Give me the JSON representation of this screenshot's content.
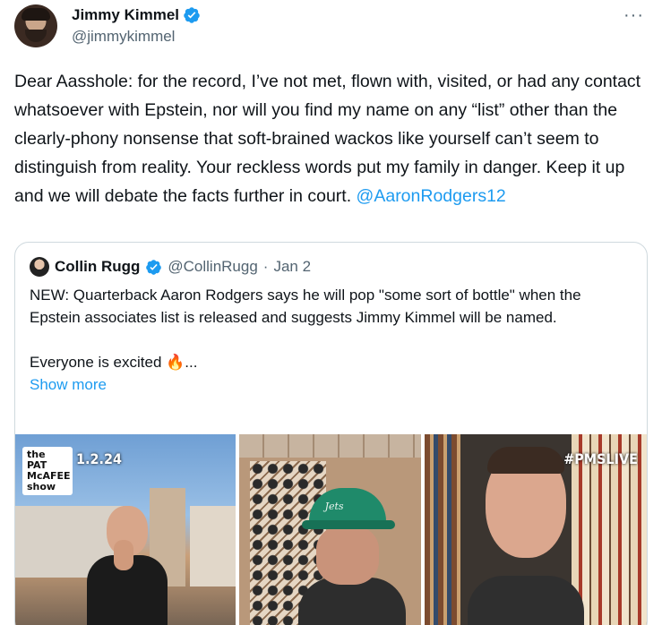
{
  "tweet": {
    "author_name": "Jimmy Kimmel",
    "author_handle": "@jimmykimmel",
    "more_label": "···",
    "text_main": "Dear Aasshole: for the record, I’ve not met, flown with, visited, or had any contact whatsoever with Epstein, nor will you find my name on any “list” other than the clearly-phony nonsense that soft-brained wackos like yourself can’t seem to distinguish from reality. Your reckless words put my family in danger. Keep it up and we will debate the facts further in court.",
    "mention": "@AaronRodgers12"
  },
  "quote": {
    "author_name": "Collin Rugg",
    "author_handle": "@CollinRugg",
    "separator": "·",
    "date": "Jan 2",
    "text_p1": "NEW: Quarterback Aaron Rodgers says he will pop \"some sort of bottle\" when the Epstein associates list is released and suggests Jimmy Kimmel will be named.",
    "text_p2": "Everyone is excited 🔥...",
    "show_more": "Show more",
    "media": {
      "logo_text": "the PAT McAFEE show",
      "date_tag": "1.2.24",
      "cap_text": "Jets",
      "hashtag": "#PMSLIVE"
    }
  },
  "colors": {
    "text": "#0f1419",
    "secondary": "#536471",
    "link": "#1d9bf0",
    "border": "#cfd9de",
    "verified": "#1d9bf0"
  }
}
